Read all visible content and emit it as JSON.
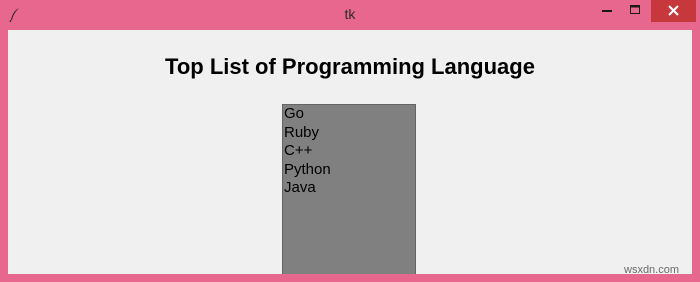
{
  "window": {
    "title": "tk",
    "icon": "feather-icon",
    "accent_color": "#e8678e",
    "close_button_color": "#c7383c"
  },
  "main": {
    "heading": "Top List of Programming Language",
    "listbox": {
      "background_color": "#808080",
      "items": [
        {
          "label": "Go"
        },
        {
          "label": "Ruby"
        },
        {
          "label": "C++"
        },
        {
          "label": "Python"
        },
        {
          "label": "Java"
        }
      ]
    }
  },
  "watermark": "wsxdn.com"
}
